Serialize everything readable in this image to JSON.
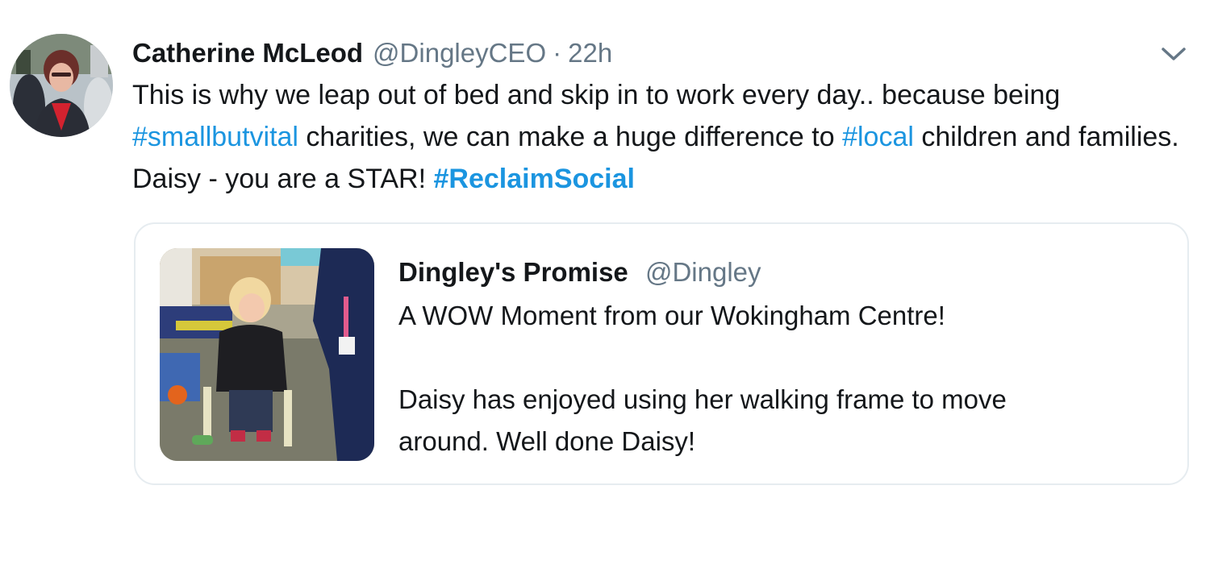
{
  "tweet": {
    "author_name": "Catherine McLeod",
    "author_handle": "@DingleyCEO",
    "separator": "·",
    "time": "22h",
    "caret_icon": "chevron-down-icon",
    "text": {
      "part1": "This is why we leap out of bed and skip in to work every day..  because being ",
      "tag1": "#smallbutvital",
      "part2": " charities, we can make a huge difference to ",
      "tag2": "#local",
      "part3": " children and families. Daisy - you are a STAR! ",
      "tag3": "#ReclaimSocial"
    },
    "link_color": "#1b95e0"
  },
  "quoted_tweet": {
    "author_name": "Dingley's Promise",
    "author_handle": "@Dingley",
    "line1": "A WOW Moment from our Wokingham Centre!",
    "line2": "Daisy has enjoyed using her walking frame to move",
    "line3": "around. Well done Daisy!"
  }
}
